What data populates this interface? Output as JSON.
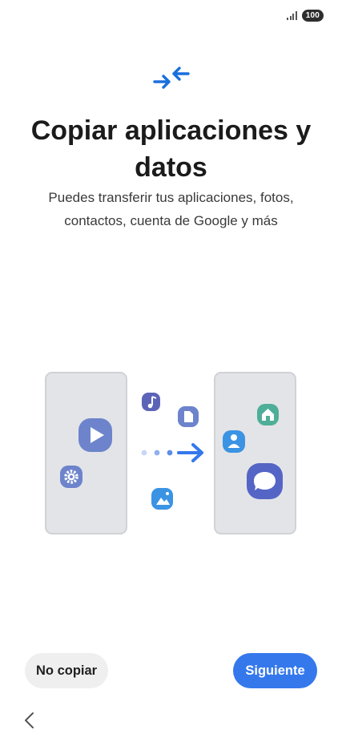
{
  "status_bar": {
    "battery": "100",
    "signal_icon": "signal-icon"
  },
  "header": {
    "icon": "transfer-arrows-icon",
    "title": "Copiar aplicaciones y datos",
    "subtitle": "Puedes transferir tus aplicaciones, fotos, contactos, cuenta de Google y más"
  },
  "illustration": {
    "icons": [
      "play-icon",
      "settings-icon",
      "music-note-icon",
      "document-icon",
      "image-icon",
      "home-icon",
      "contact-icon",
      "message-icon",
      "arrow-right-icon"
    ]
  },
  "actions": {
    "secondary_label": "No copiar",
    "primary_label": "Siguiente"
  },
  "navigation": {
    "back_icon": "back-chevron-icon"
  },
  "colors": {
    "accent": "#3478ec",
    "phone_fill": "#e3e4e7",
    "play": "#6d84cc",
    "message": "#5565c6"
  }
}
